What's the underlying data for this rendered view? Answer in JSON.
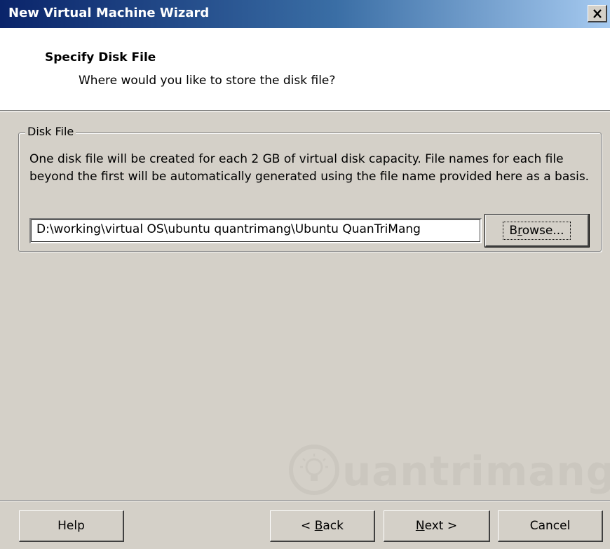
{
  "window": {
    "title": "New Virtual Machine Wizard"
  },
  "header": {
    "title": "Specify Disk File",
    "subtitle": "Where would you like to store the disk file?"
  },
  "disk_file": {
    "group_label": "Disk File",
    "description": "One disk file will be created for each 2 GB of virtual disk capacity. File names for each file beyond the first will be automatically generated using the file name provided here as a basis.",
    "path_value": "D:\\working\\virtual OS\\ubuntu quantrimang\\Ubuntu QuanTriMang",
    "browse": {
      "pre": "B",
      "key": "r",
      "post": "owse..."
    }
  },
  "footer": {
    "help": "Help",
    "back": {
      "pre": "< ",
      "key": "B",
      "post": "ack"
    },
    "next": {
      "pre": "",
      "key": "N",
      "post": "ext >"
    },
    "cancel": "Cancel"
  },
  "watermark": {
    "text": "uantrimang"
  },
  "icons": {
    "close": "close-icon",
    "watermark_logo": "lightbulb-icon"
  }
}
